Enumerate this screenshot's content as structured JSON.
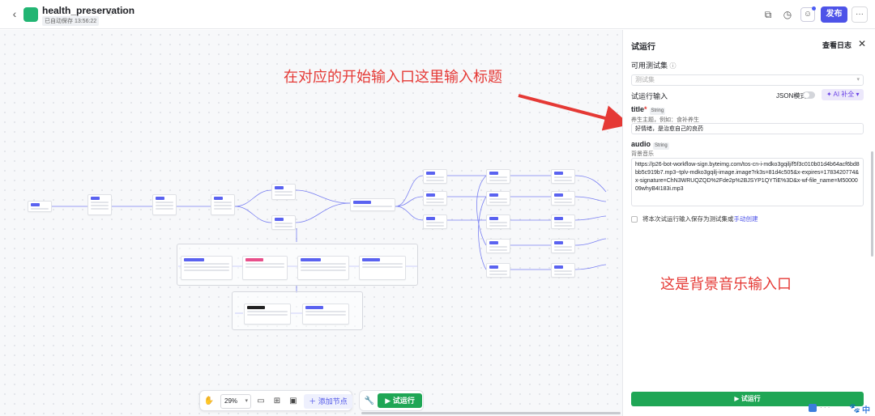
{
  "header": {
    "title": "health_preservation",
    "autosave": "已自动保存 13:56:22",
    "publish": "发布",
    "more": "···"
  },
  "canvas": {
    "annotation_title": "在对应的开始输入口这里输入标题",
    "annotation_audio": "这是背景音乐输入口"
  },
  "bottom_toolbar": {
    "zoom": "29%",
    "add_node": "添加节点",
    "run": "试运行"
  },
  "panel": {
    "title": "试运行",
    "view_log": "查看日志",
    "test_set_label": "可用测试集",
    "test_set_placeholder": "测试集",
    "run_input_label": "试运行输入",
    "json_mode": "JSON模式",
    "ai_fill": "AI 补全",
    "fields": [
      {
        "name": "title",
        "type": "String",
        "hint": "养生主题，例如：食补养生",
        "value": "好情绪，是治愈自己的良药"
      },
      {
        "name": "audio",
        "type": "String",
        "hint": "背景音乐",
        "value": "https://p26-bot-workflow-sign.byteimg.com/tos-cn-i-mdko3gqilj/f5f3c010b01d4b64acf6bd8bb5c919b7.mp3~tplv-mdko3gqilj-image.image?rk3s=81d4c505&x-expires=1783420774&x-signature=ChN3WRUQZQD%2Fde2p%2BJSYP1QYTiE%3D&x-wf-file_name=M5000009whyB4I183i.mp3"
      }
    ],
    "save_checkbox": "将本次试运行输入保存为测试集或",
    "manual_create": "手动创建",
    "run_button": "试运行"
  },
  "ime": {
    "label": "中"
  }
}
